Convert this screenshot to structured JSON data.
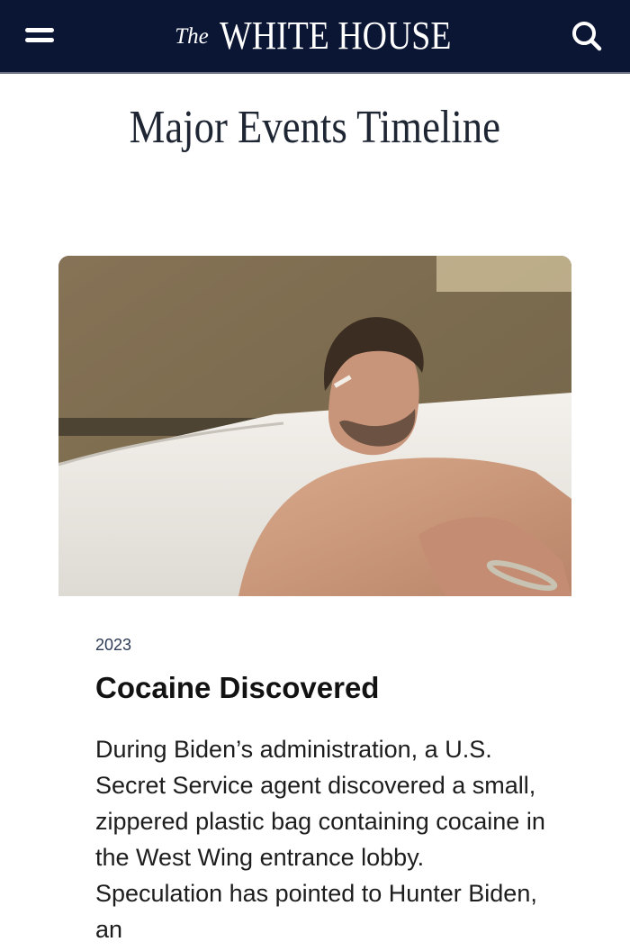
{
  "header": {
    "logo_prefix": "The",
    "logo_main": "WHITE HOUSE",
    "menu_icon": "hamburger-menu-icon",
    "search_icon": "search-icon",
    "background_color": "#0b1534"
  },
  "page": {
    "title": "Major Events Timeline"
  },
  "event": {
    "image_alt": "photo",
    "year": "2023",
    "title": "Cocaine Discovered",
    "body": "During Biden’s administration, a U.S. Secret Service agent discovered a small, zippered plastic bag containing cocaine in the West Wing entrance lobby. Speculation has pointed to Hunter Biden, an"
  }
}
